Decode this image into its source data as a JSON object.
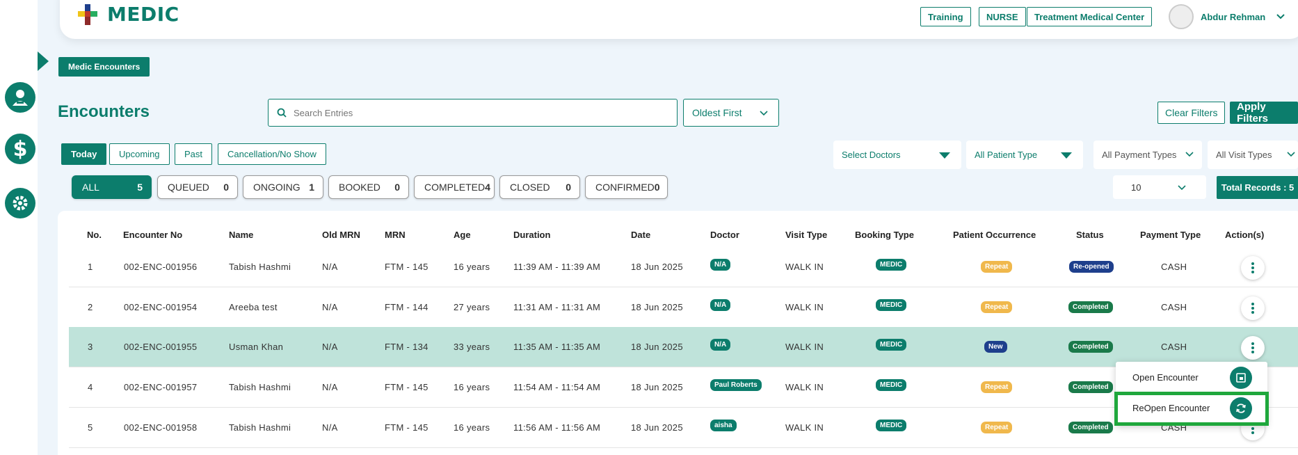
{
  "header": {
    "app_title": "MEDIC",
    "buttons": [
      "Training",
      "NURSE",
      "Treatment Medical Center"
    ],
    "user_name": "Abdur Rehman"
  },
  "breadcrumb": "Medic Encounters",
  "page_title": "Encounters",
  "search": {
    "placeholder": "Search Entries"
  },
  "sort": {
    "selected": "Oldest First"
  },
  "actions": {
    "clear": "Clear Filters",
    "apply": "Apply Filters"
  },
  "tabs": [
    "Today",
    "Upcoming",
    "Past",
    "Cancellation/No Show"
  ],
  "filters": {
    "doctors": "Select Doctors",
    "patient_type": "All Patient Type",
    "payment_types": "All Payment Types",
    "visit_types": "All Visit Types"
  },
  "status_counts": [
    {
      "label": "ALL",
      "count": "5"
    },
    {
      "label": "QUEUED",
      "count": "0"
    },
    {
      "label": "ONGOING",
      "count": "1"
    },
    {
      "label": "BOOKED",
      "count": "0"
    },
    {
      "label": "COMPLETED",
      "count": "4"
    },
    {
      "label": "CLOSED",
      "count": "0"
    },
    {
      "label": "CONFIRMED",
      "count": "0"
    }
  ],
  "per_page": "10",
  "total_records": "Total Records : 5",
  "table": {
    "columns": [
      "No.",
      "Encounter No",
      "Name",
      "Old MRN",
      "MRN",
      "Age",
      "Duration",
      "Date",
      "Doctor",
      "Visit Type",
      "Booking Type",
      "Patient Occurrence",
      "Status",
      "Payment Type",
      "Action(s)"
    ],
    "rows": [
      {
        "no": "1",
        "enc": "002-ENC-001956",
        "name": "Tabish Hashmi",
        "old_mrn": "N/A",
        "mrn": "FTM - 145",
        "age": "16 years",
        "duration": "11:39 AM - 11:39 AM",
        "date": "18 Jun 2025",
        "doctor": "N/A",
        "visit": "WALK IN",
        "booking": "MEDIC",
        "occurrence": "Repeat",
        "status": "Re-opened",
        "payment": "CASH"
      },
      {
        "no": "2",
        "enc": "002-ENC-001954",
        "name": "Areeba test",
        "old_mrn": "N/A",
        "mrn": "FTM - 144",
        "age": "27 years",
        "duration": "11:31 AM - 11:31 AM",
        "date": "18 Jun 2025",
        "doctor": "N/A",
        "visit": "WALK IN",
        "booking": "MEDIC",
        "occurrence": "Repeat",
        "status": "Completed",
        "payment": "CASH"
      },
      {
        "no": "3",
        "enc": "002-ENC-001955",
        "name": "Usman Khan",
        "old_mrn": "N/A",
        "mrn": "FTM - 134",
        "age": "33 years",
        "duration": "11:35 AM - 11:35 AM",
        "date": "18 Jun 2025",
        "doctor": "N/A",
        "visit": "WALK IN",
        "booking": "MEDIC",
        "occurrence": "New",
        "status": "Completed",
        "payment": "CASH"
      },
      {
        "no": "4",
        "enc": "002-ENC-001957",
        "name": "Tabish Hashmi",
        "old_mrn": "N/A",
        "mrn": "FTM - 145",
        "age": "16 years",
        "duration": "11:54 AM - 11:54 AM",
        "date": "18 Jun 2025",
        "doctor": "Paul Roberts",
        "visit": "WALK IN",
        "booking": "MEDIC",
        "occurrence": "Repeat",
        "status": "Completed",
        "payment": ""
      },
      {
        "no": "5",
        "enc": "002-ENC-001958",
        "name": "Tabish Hashmi",
        "old_mrn": "N/A",
        "mrn": "FTM - 145",
        "age": "16 years",
        "duration": "11:56 AM - 11:56 AM",
        "date": "18 Jun 2025",
        "doctor": "aisha",
        "visit": "WALK IN",
        "booking": "MEDIC",
        "occurrence": "Repeat",
        "status": "Completed",
        "payment": "CASH"
      }
    ]
  },
  "action_menu": {
    "open": "Open Encounter",
    "reopen": "ReOpen Encounter"
  },
  "colors": {
    "brand": "#0c7d6c",
    "highlight_row": "#bfe3da",
    "repeat": "#f0b84c",
    "new": "#1e3f8c",
    "focus_box": "#1fa73c"
  }
}
